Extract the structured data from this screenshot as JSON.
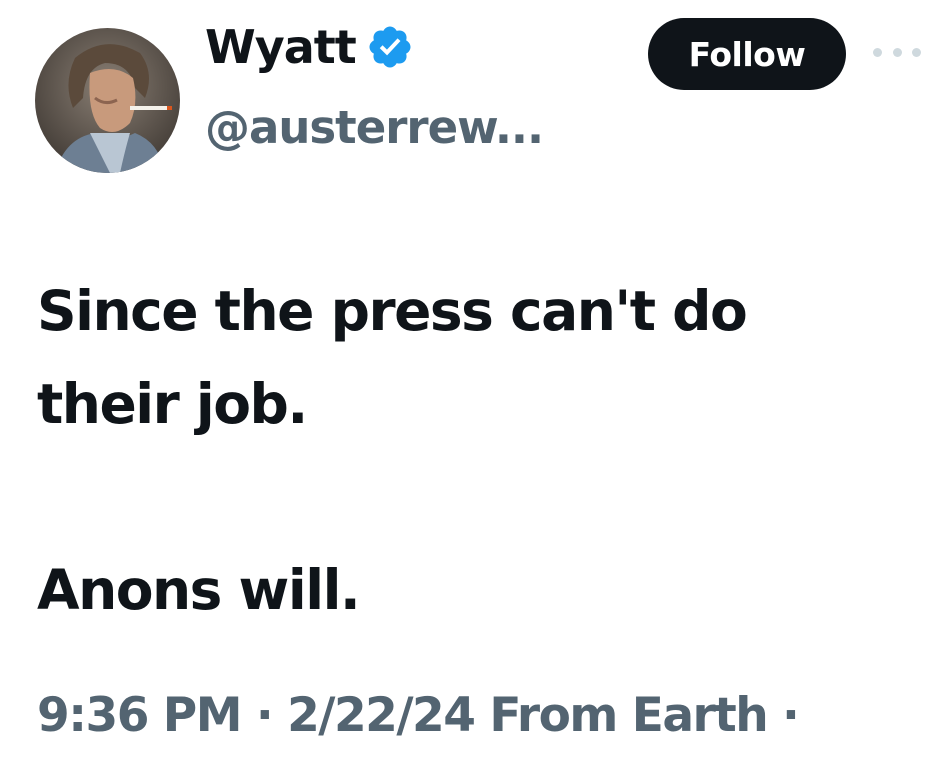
{
  "author": {
    "display_name": "Wyatt",
    "handle": "@austerrew...",
    "verified": true,
    "avatar_icon": "avatar-photo"
  },
  "actions": {
    "follow_label": "Follow",
    "more_icon": "more-horizontal-icon"
  },
  "tweet": {
    "paragraphs": [
      "Since the press can't do their job.",
      "Anons will."
    ]
  },
  "meta": {
    "time": "9:36 PM",
    "separator": "·",
    "date": "2/22/24",
    "source": "From Earth",
    "trailing": "·"
  },
  "colors": {
    "text_primary": "#0f1419",
    "text_secondary": "#536471",
    "verified_blue": "#1d9bf0",
    "follow_bg": "#0f1419",
    "follow_text": "#ffffff"
  }
}
